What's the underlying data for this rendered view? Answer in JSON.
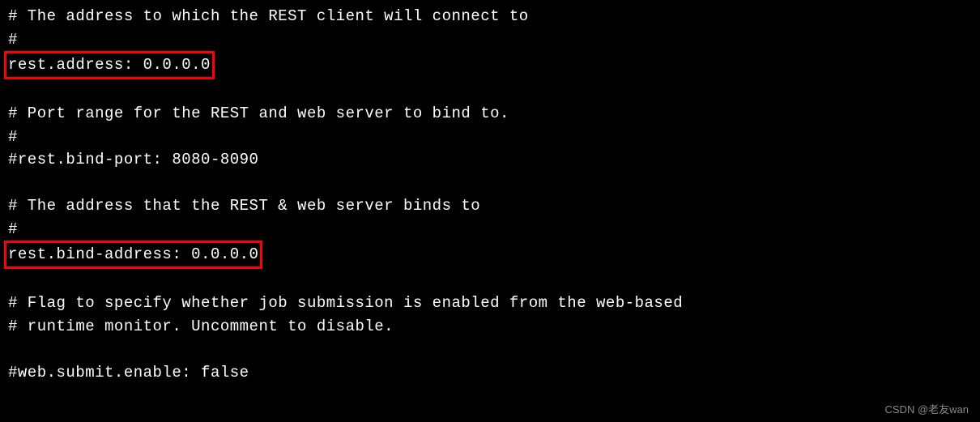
{
  "lines": {
    "l1": "# The address to which the REST client will connect to",
    "l2": "#",
    "l3": "rest.address: 0.0.0.0",
    "l4": "",
    "l5": "# Port range for the REST and web server to bind to.",
    "l6": "#",
    "l7": "#rest.bind-port: 8080-8090",
    "l8": "",
    "l9": "# The address that the REST & web server binds to",
    "l10": "#",
    "l11": "rest.bind-address: 0.0.0.0",
    "l12": "",
    "l13": "# Flag to specify whether job submission is enabled from the web-based",
    "l14": "# runtime monitor. Uncomment to disable.",
    "l15": "",
    "l16": "#web.submit.enable: false"
  },
  "watermark": "CSDN @老友wan"
}
